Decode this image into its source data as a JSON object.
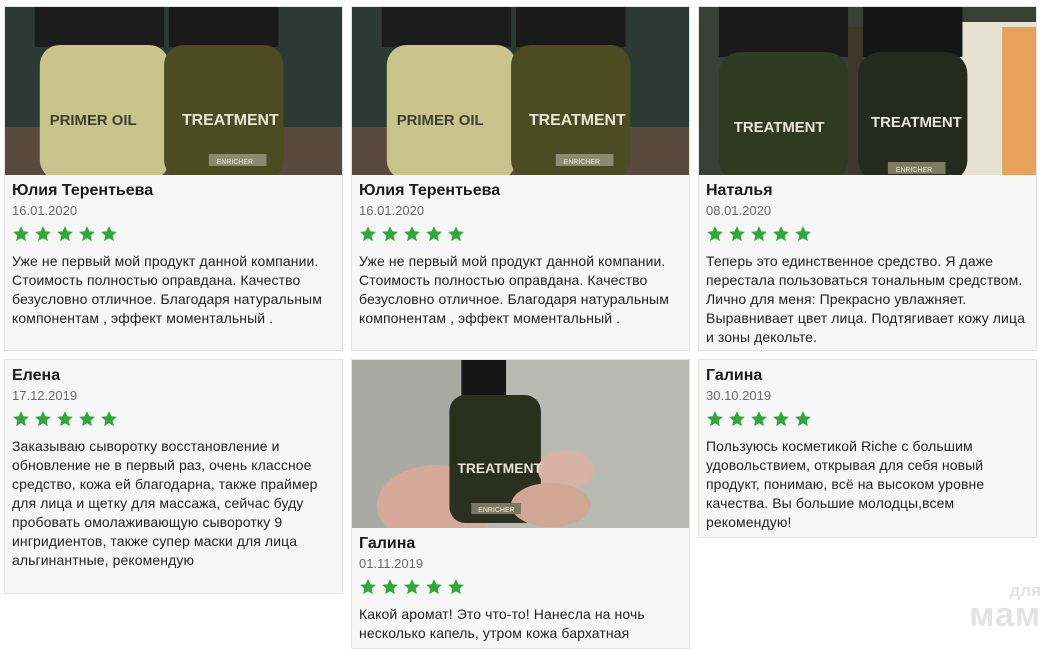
{
  "colors": {
    "star": "#2fa83a",
    "card_bg": "#f7f7f7",
    "card_border": "#e2e2e2"
  },
  "reviews": [
    {
      "author": "Юлия Терентьева",
      "date": "16.01.2020",
      "rating": 5,
      "text": "Уже не первый мой продукт данной компании. Стоимость полностью оправдана. Качество безусловно отличное. Благодаря натуральным компонентам , эффект моментальный .",
      "photo": {
        "labels": [
          "PRIMER OIL",
          "TREATMENT",
          "ENRICHER"
        ]
      }
    },
    {
      "author": "Юлия Терентьева",
      "date": "16.01.2020",
      "rating": 5,
      "text": "Уже не первый мой продукт данной компании. Стоимость полностью оправдана. Качество безусловно отличное. Благодаря натуральным компонентам , эффект моментальный .",
      "photo": {
        "labels": [
          "PRIMER OIL",
          "TREATMENT",
          "ENRICHER"
        ]
      }
    },
    {
      "author": "Наталья",
      "date": "08.01.2020",
      "rating": 5,
      "text": "Теперь это единственное средство. Я даже перестала пользоваться тональным средством. Лично для меня: Прекрасно увлажняет. Выравнивает цвет лица. Подтягивает кожу лица и зоны декольте.",
      "photo": {
        "labels": [
          "TREATMENT",
          "TREATMENT",
          "ENRICHER"
        ]
      }
    },
    {
      "author": "Елена",
      "date": "17.12.2019",
      "rating": 5,
      "text": "Заказываю сыворотку восстановление и обновление не в первый раз, очень классное средство, кожа ей благодарна, также праймер для лица и щетку для массажа, сейчас буду пробовать омолаживающую сыворотку 9 ингридиентов, также супер маски для лица альгинантные, рекомендую"
    },
    {
      "author": "Галина",
      "date": "01.11.2019",
      "rating": 5,
      "text": "Какой аромат! Это что-то! Нанесла на ночь несколько капель, утром кожа бархатная",
      "photo": {
        "labels": [
          "TREATMENT",
          "ENRICHER"
        ]
      }
    },
    {
      "author": "Галина",
      "date": "30.10.2019",
      "rating": 5,
      "text": "Пользуюсь косметикой Riche с большим удовольствием, открывая для себя новый продукт, понимаю, всё на высоком уровне качества. Вы большие молодцы,всем рекомендую!"
    }
  ],
  "watermark": {
    "line1": "для",
    "line2": "мам"
  }
}
